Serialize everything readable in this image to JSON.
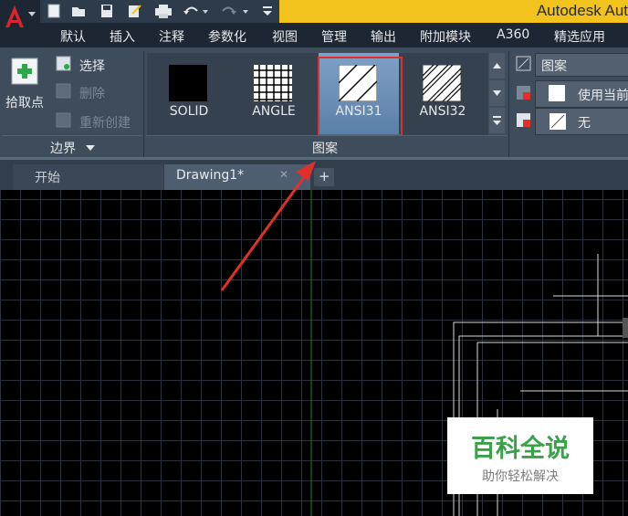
{
  "app": {
    "title": "Autodesk Aut",
    "logo_letter": "A"
  },
  "menu": {
    "items": [
      "默认",
      "插入",
      "注释",
      "参数化",
      "视图",
      "管理",
      "输出",
      "附加模块",
      "A360",
      "精选应用"
    ]
  },
  "ribbon": {
    "boundary_panel": {
      "pick_points_label": "拾取点",
      "select_label": "选择",
      "remove_label": "删除",
      "recreate_label": "重新创建",
      "panel_title": "边界"
    },
    "pattern_panel": {
      "patterns": [
        {
          "label": "SOLID",
          "icon": "solid-swatch",
          "selected": false
        },
        {
          "label": "ANGLE",
          "icon": "angle-grid-swatch",
          "selected": false
        },
        {
          "label": "ANSI31",
          "icon": "ansi31-hatch-swatch",
          "selected": true
        },
        {
          "label": "ANSI32",
          "icon": "ansi32-hatch-swatch",
          "selected": false
        }
      ],
      "panel_title": "图案"
    },
    "properties_panel": {
      "type_value": "图案",
      "color_value": "使用当前",
      "background_value": "无"
    }
  },
  "doc_tabs": {
    "start_label": "开始",
    "drawing_label": "Drawing1*",
    "close_glyph": "✕",
    "add_glyph": "+"
  },
  "watermark": {
    "title": "百科全说",
    "subtitle": "助你轻松解决"
  },
  "colors": {
    "title_yellow": "#f2c31d",
    "ribbon_bg": "#3f4c5b",
    "selection_red": "#e0302b",
    "arrow_red": "#e0302b",
    "watermark_green": "#3aa14a"
  }
}
